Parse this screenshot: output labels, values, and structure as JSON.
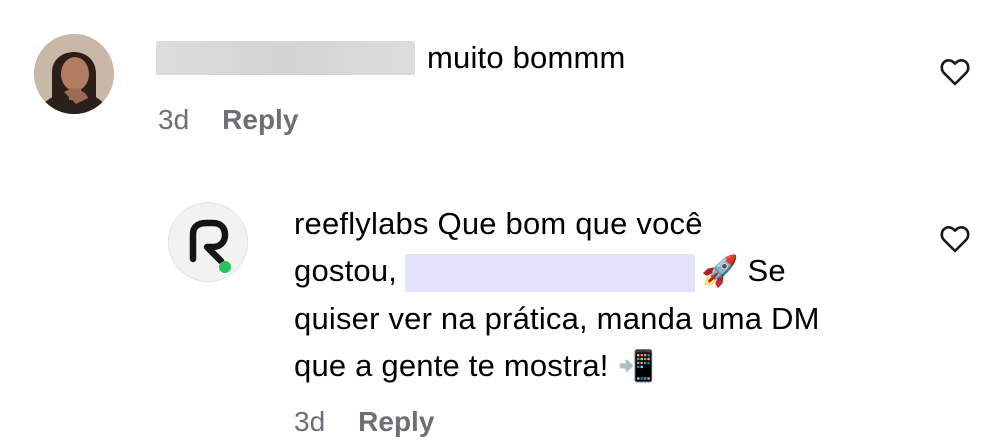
{
  "comment": {
    "text": "muito bommm",
    "age": "3d",
    "reply_label": "Reply"
  },
  "reply": {
    "username": "reeflylabs",
    "text_part1": "Que bom que você",
    "text_part2": "gostou,",
    "emoji_rocket": "🚀",
    "text_part3": "Se",
    "text_part4": "quiser ver na prática, manda uma DM",
    "text_part5": "que a gente te mostra!",
    "emoji_phone": "📲",
    "age": "3d",
    "reply_label": "Reply",
    "avatar_accent": "#22c55e"
  },
  "icons": {
    "like": "heart-outline-icon"
  }
}
